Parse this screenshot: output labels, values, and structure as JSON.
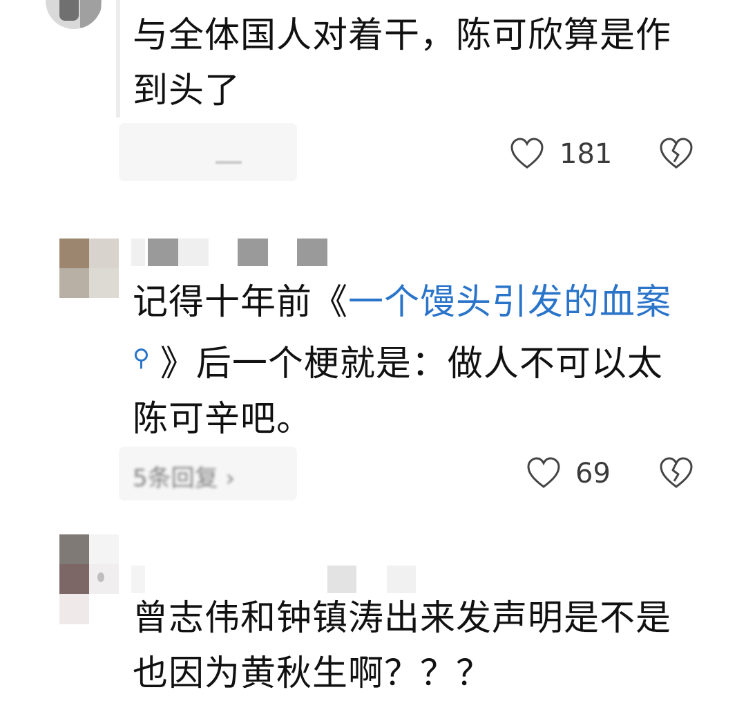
{
  "comments": [
    {
      "text_lines": [
        "与全体国人对着干，陈可欣算是作",
        "到头了"
      ],
      "likes": "181"
    },
    {
      "text_line1_prefix": "记得十年前《",
      "text_line1_link": "一个馒头引发的血案",
      "link_search_icon": "search-icon",
      "text_line2": "》后一个梗就是：做人不可以太",
      "text_line3": "陈可辛吧。",
      "reply_chip_text": "5条回复 ›",
      "likes": "69"
    },
    {
      "text_lines": [
        "曾志伟和钟镇涛出来发声明是不是",
        "也因为黄秋生啊？？？"
      ]
    }
  ],
  "icons": {
    "like": "heart-outline-icon",
    "dislike": "broken-heart-icon"
  },
  "colors": {
    "text": "#111111",
    "link": "#2a74c9",
    "count": "#3b3b3b"
  }
}
